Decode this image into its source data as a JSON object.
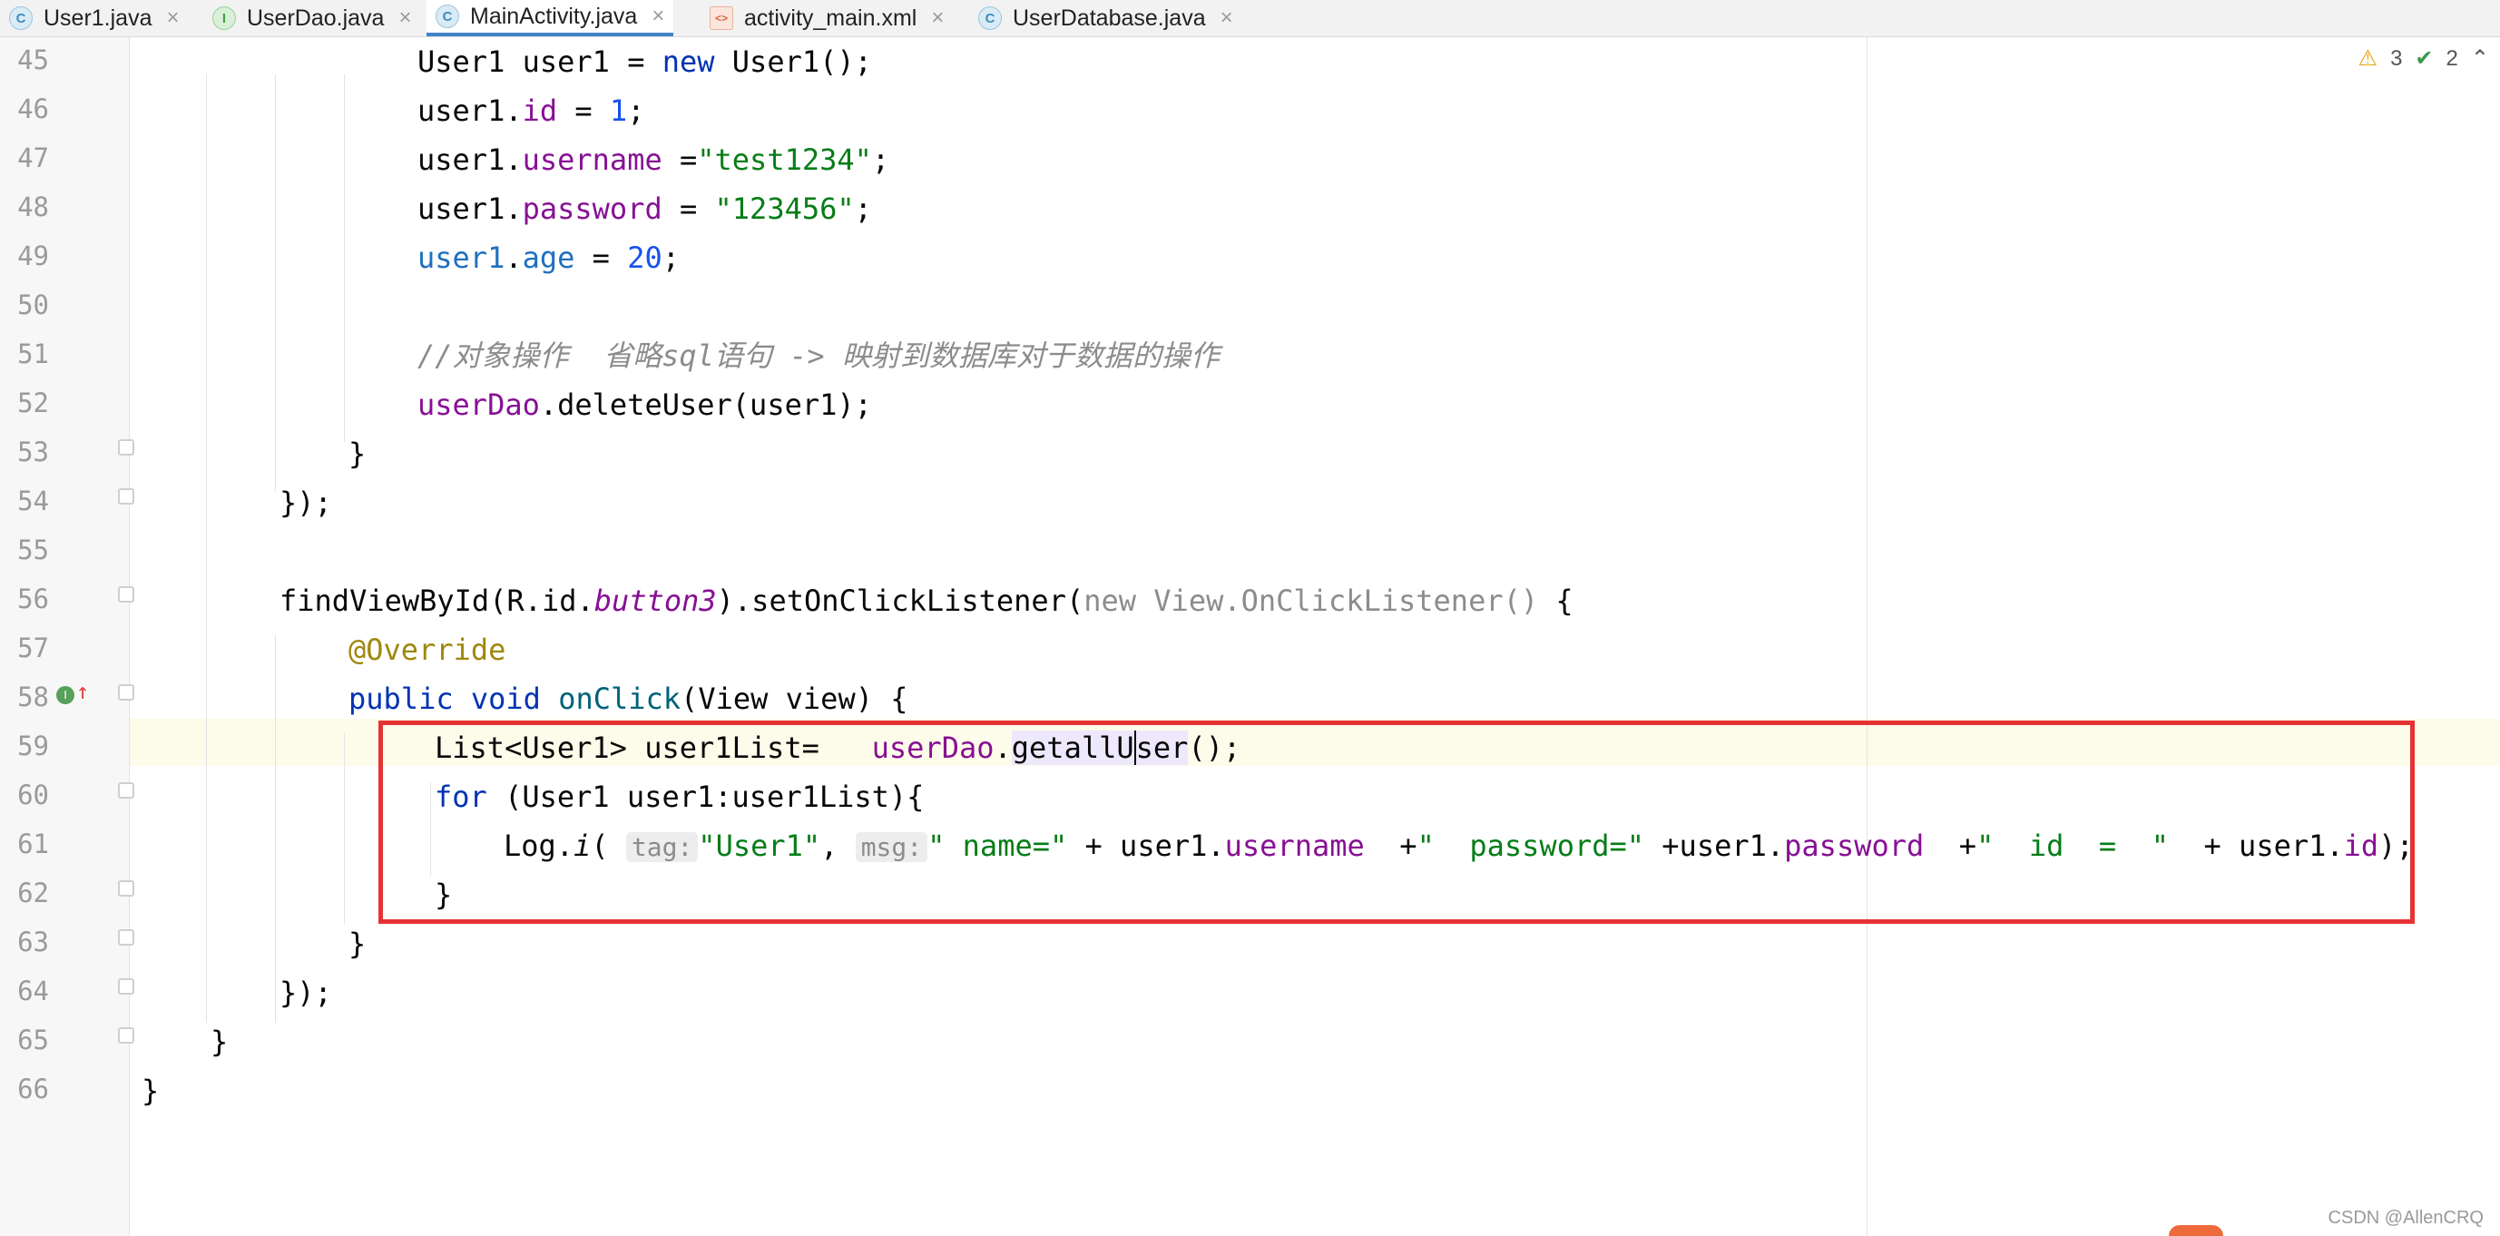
{
  "tabs": [
    {
      "icon": "C",
      "kind": "class",
      "label": "User1.java"
    },
    {
      "icon": "I",
      "kind": "interface",
      "label": "UserDao.java"
    },
    {
      "icon": "C",
      "kind": "class",
      "label": "MainActivity.java",
      "active": true
    },
    {
      "icon": "<>",
      "kind": "xml",
      "label": "activity_main.xml"
    },
    {
      "icon": "C",
      "kind": "class",
      "label": "UserDatabase.java"
    }
  ],
  "close_glyph": "×",
  "inspection": {
    "warnings": "3",
    "weak_warnings": "2",
    "warn_icon": "⚠",
    "ok_icon": "✔",
    "collapse_icon": "⌃"
  },
  "line_numbers": [
    "45",
    "46",
    "47",
    "48",
    "49",
    "50",
    "51",
    "52",
    "53",
    "54",
    "55",
    "56",
    "57",
    "58",
    "59",
    "60",
    "61",
    "62",
    "63",
    "64",
    "65",
    "66"
  ],
  "gutter_badge": {
    "letter": "I",
    "arrow": "↑"
  },
  "code": {
    "l45": {
      "a": "User1 user1 = ",
      "b": "new",
      "c": " User1();"
    },
    "l46": {
      "a": "user1.",
      "b": "id",
      "c": " = ",
      "d": "1",
      "e": ";"
    },
    "l47": {
      "a": "user1.",
      "b": "username",
      "c": " =",
      "d": "\"test1234\"",
      "e": ";"
    },
    "l48": {
      "a": "user1.",
      "b": "password",
      "c": " = ",
      "d": "\"123456\"",
      "e": ";"
    },
    "l49": {
      "a": "user1",
      "b": ".",
      "c": "age",
      "d": " = ",
      "e": "20",
      "f": ";"
    },
    "l51": {
      "a": "//对象操作  省略sql语句 -> 映射到数据库对于数据的操作"
    },
    "l52": {
      "a": "userDao",
      "b": ".deleteUser(user1);"
    },
    "l53": {
      "a": "}"
    },
    "l54": {
      "a": "});"
    },
    "l56": {
      "a": "findViewById(R.id.",
      "b": "button3",
      "c": ").setOnClickListener(",
      "d": "new View.OnClickListener()",
      "e": " {"
    },
    "l57": {
      "a": "@Override"
    },
    "l58": {
      "a": "public",
      "b": " ",
      "c": "void",
      "d": " onClick",
      "e": "(View view) {"
    },
    "l59": {
      "a": "List<User1> user1List=   ",
      "b": "userDao",
      "c": ".",
      "d": "getallU",
      "e": "ser",
      "f": "();"
    },
    "l60": {
      "a": "for",
      "b": " (User1 user1:user1List){"
    },
    "l61": {
      "a": "Log.",
      "b": "i",
      "c": "(",
      "d": "tag:",
      "e": "\"User1\"",
      "f": ",",
      "g": "msg:",
      "h": "\" name=\"",
      "i": " + user1.",
      "j": "username",
      "k": "  +",
      "l": "\"  password=\"",
      "m": " +user1.",
      "n": "password",
      "o": "  +",
      "p": "\"  id  =  \"",
      "q": "  + user1.",
      "r": "id",
      "s": ");"
    },
    "l62": {
      "a": "}"
    },
    "l63": {
      "a": "}"
    },
    "l64": {
      "a": "});"
    },
    "l65": {
      "a": "}"
    },
    "l66": {
      "a": "}"
    }
  },
  "watermark": "CSDN @AllenCRQ",
  "colors": {
    "keyword": "#0033b3",
    "field": "#871094",
    "string": "#067d17",
    "number": "#1750eb",
    "highlight_box": "#e53333"
  }
}
